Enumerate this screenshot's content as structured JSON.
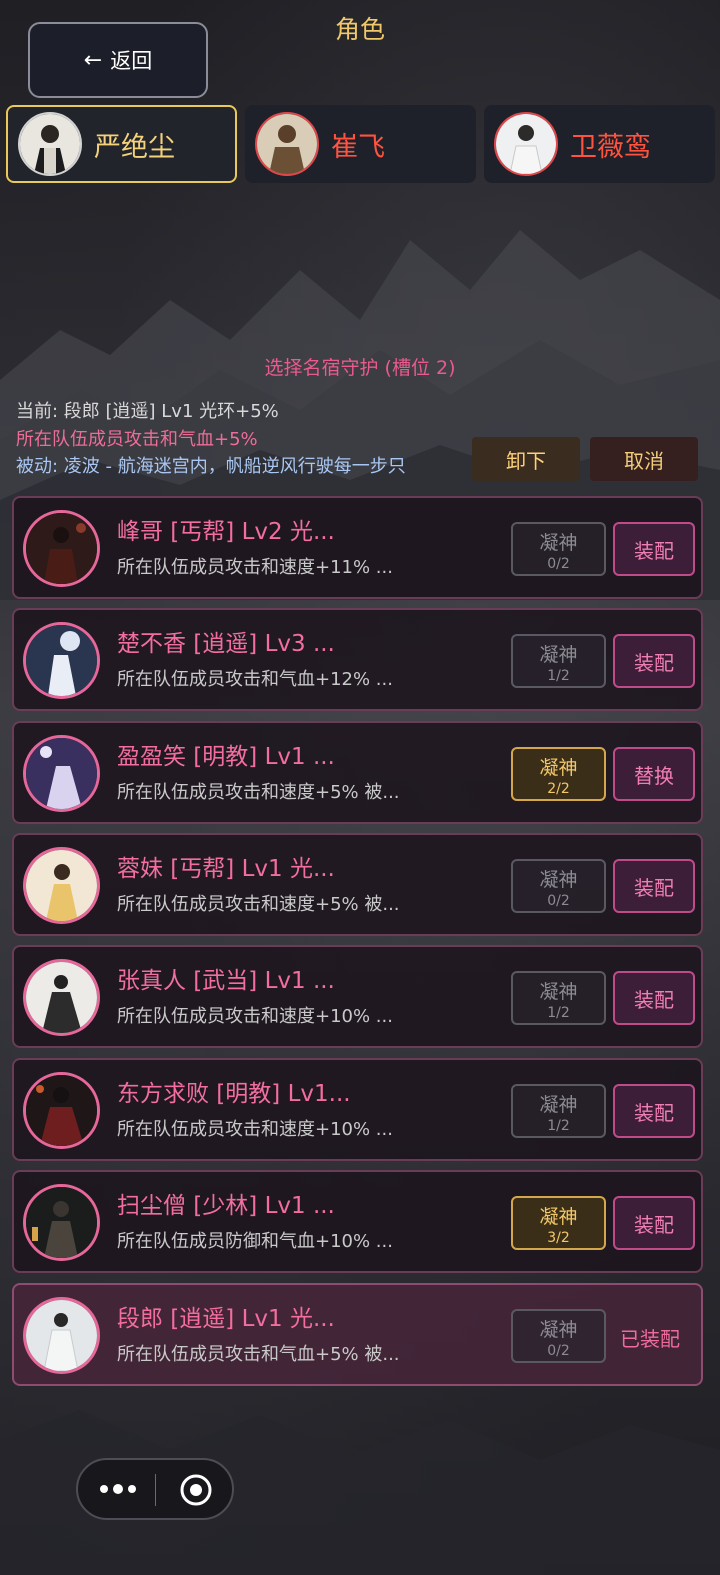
{
  "header": {
    "title": "角色",
    "back_label": "返回"
  },
  "characters": [
    {
      "name": "严绝尘",
      "active": true
    },
    {
      "name": "崔飞",
      "active": false
    },
    {
      "name": "卫薇鸾",
      "active": false
    }
  ],
  "selection": {
    "title": "选择名宿守护 (槽位 2)",
    "current_line": "当前: 段郎 [逍遥] Lv1 光环+5%",
    "current_effect": "所在队伍成员攻击和气血+5%",
    "passive": "被动: 凌波 - 航海迷宫内，帆船逆风行驶每一步只",
    "unequip_label": "卸下",
    "cancel_label": "取消"
  },
  "guardians": [
    {
      "name": "峰哥 [丐帮] Lv2 光...",
      "desc": "所在队伍成员攻击和速度+11% ...",
      "focus_label": "凝神",
      "focus_count": "0/2",
      "focus_full": false,
      "action": "装配"
    },
    {
      "name": "楚不香 [逍遥] Lv3 ...",
      "desc": "所在队伍成员攻击和气血+12% ...",
      "focus_label": "凝神",
      "focus_count": "1/2",
      "focus_full": false,
      "action": "装配"
    },
    {
      "name": "盈盈笑 [明教] Lv1 ...",
      "desc": "所在队伍成员攻击和速度+5% 被...",
      "focus_label": "凝神",
      "focus_count": "2/2",
      "focus_full": true,
      "action": "替换"
    },
    {
      "name": "蓉妹 [丐帮] Lv1 光...",
      "desc": "所在队伍成员攻击和速度+5% 被...",
      "focus_label": "凝神",
      "focus_count": "0/2",
      "focus_full": false,
      "action": "装配"
    },
    {
      "name": "张真人 [武当] Lv1 ...",
      "desc": "所在队伍成员攻击和速度+10% ...",
      "focus_label": "凝神",
      "focus_count": "1/2",
      "focus_full": false,
      "action": "装配"
    },
    {
      "name": "东方求败 [明教] Lv1...",
      "desc": "所在队伍成员攻击和速度+10% ...",
      "focus_label": "凝神",
      "focus_count": "1/2",
      "focus_full": false,
      "action": "装配"
    },
    {
      "name": "扫尘僧 [少林] Lv1 ...",
      "desc": "所在队伍成员防御和气血+10% ...",
      "focus_label": "凝神",
      "focus_count": "3/2",
      "focus_full": true,
      "action": "装配"
    },
    {
      "name": "段郎 [逍遥] Lv1 光...",
      "desc": "所在队伍成员攻击和气血+5% 被...",
      "focus_label": "凝神",
      "focus_count": "0/2",
      "focus_full": false,
      "action": "已装配",
      "current": true
    }
  ],
  "icons": {
    "back": "arrow-left-icon",
    "more": "more-dots-icon",
    "close": "target-close-icon"
  },
  "colors": {
    "accent_gold": "#f1c86a",
    "accent_pink": "#f36e9e",
    "accent_red": "#ff5340"
  }
}
